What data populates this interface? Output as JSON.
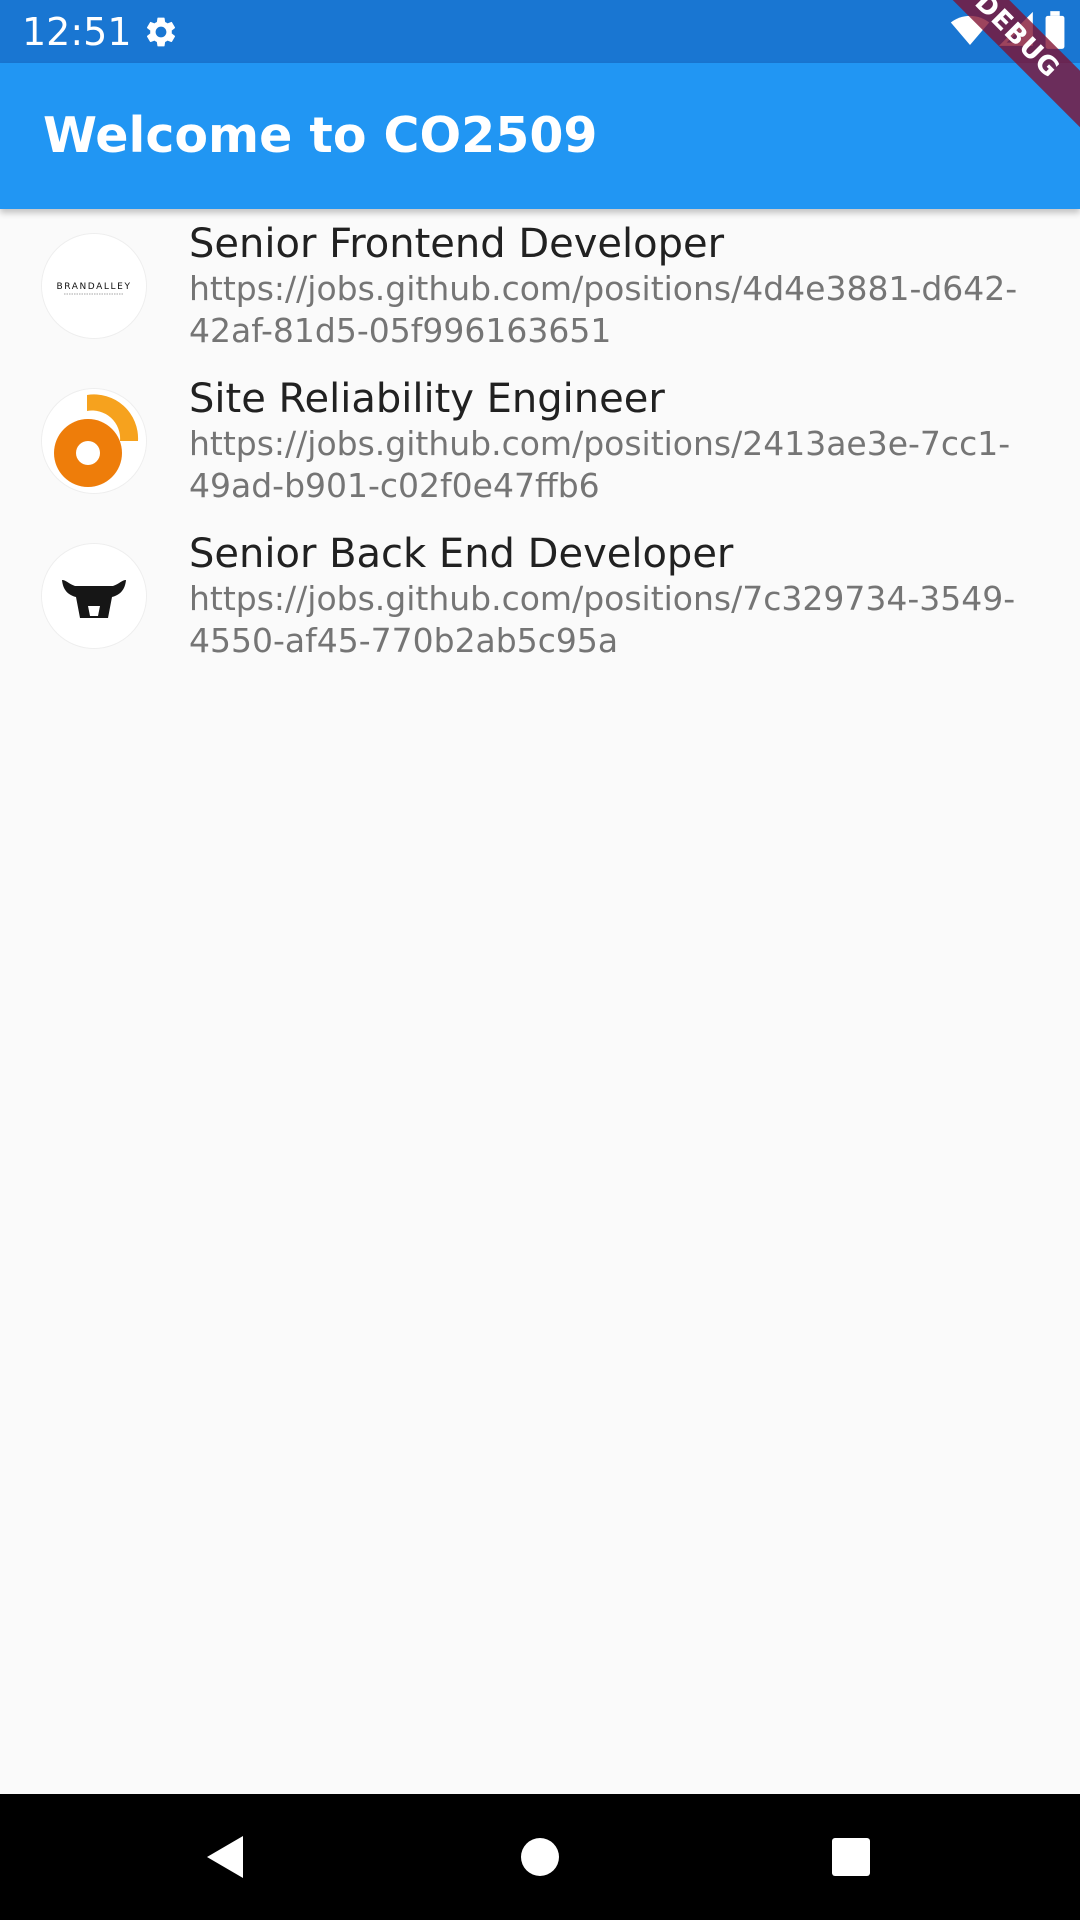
{
  "status_bar": {
    "time": "12:51",
    "icons": [
      "gear-icon",
      "wifi-icon",
      "signal-icon",
      "battery-icon"
    ],
    "background": "#1976d2"
  },
  "debug_banner": {
    "label": "DEBUG",
    "color": "#801030"
  },
  "app_bar": {
    "title": "Welcome to CO2509",
    "background": "#2196f3"
  },
  "jobs": [
    {
      "title": "Senior Frontend Developer",
      "url": "https://jobs.github.com/positions/4d4e3881-d642-42af-81d5-05f996163651",
      "logo": "brandalley-logo",
      "logo_text": "BRANDALLEY"
    },
    {
      "title": "Site Reliability Engineer",
      "url": "https://jobs.github.com/positions/2413ae3e-7cc1-49ad-b901-c02f0e47ffb6",
      "logo": "orange-ring-logo"
    },
    {
      "title": "Senior Back End Developer",
      "url": "https://jobs.github.com/positions/7c329734-3549-4550-af45-770b2ab5c95a",
      "logo": "bull-logo"
    }
  ],
  "nav_bar": {
    "icons": [
      "back-icon",
      "home-icon",
      "recents-icon"
    ]
  }
}
